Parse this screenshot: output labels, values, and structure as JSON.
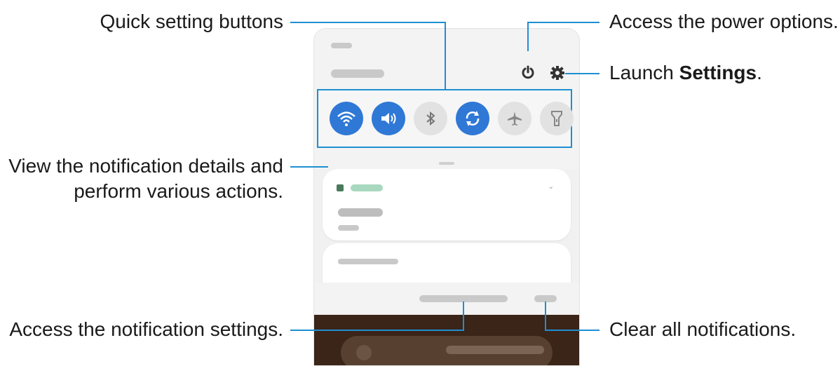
{
  "callouts": {
    "quick_settings": "Quick setting buttons",
    "power": "Access the power options.",
    "settings_prefix": "Launch ",
    "settings_bold": "Settings",
    "settings_suffix": ".",
    "notification_details_line1": "View the notification details and",
    "notification_details_line2": "perform various actions.",
    "notification_settings": "Access the notification settings.",
    "clear": "Clear all notifications."
  },
  "quick_settings": [
    {
      "name": "wifi",
      "icon": "wifi-icon",
      "state": "on"
    },
    {
      "name": "sound",
      "icon": "sound-icon",
      "state": "on"
    },
    {
      "name": "bluetooth",
      "icon": "bluetooth-icon",
      "state": "off"
    },
    {
      "name": "auto-rotate",
      "icon": "auto-rotate-icon",
      "state": "on"
    },
    {
      "name": "airplane",
      "icon": "airplane-icon",
      "state": "off"
    },
    {
      "name": "flashlight",
      "icon": "flashlight-icon",
      "state": "off"
    }
  ],
  "header_icons": [
    "power-icon",
    "gear-icon"
  ],
  "colors": {
    "callout_line": "#1d8fd1",
    "toggle_on": "#2f78d6",
    "toggle_off": "#e2e2e2",
    "app_accent": "#4caf7d"
  }
}
